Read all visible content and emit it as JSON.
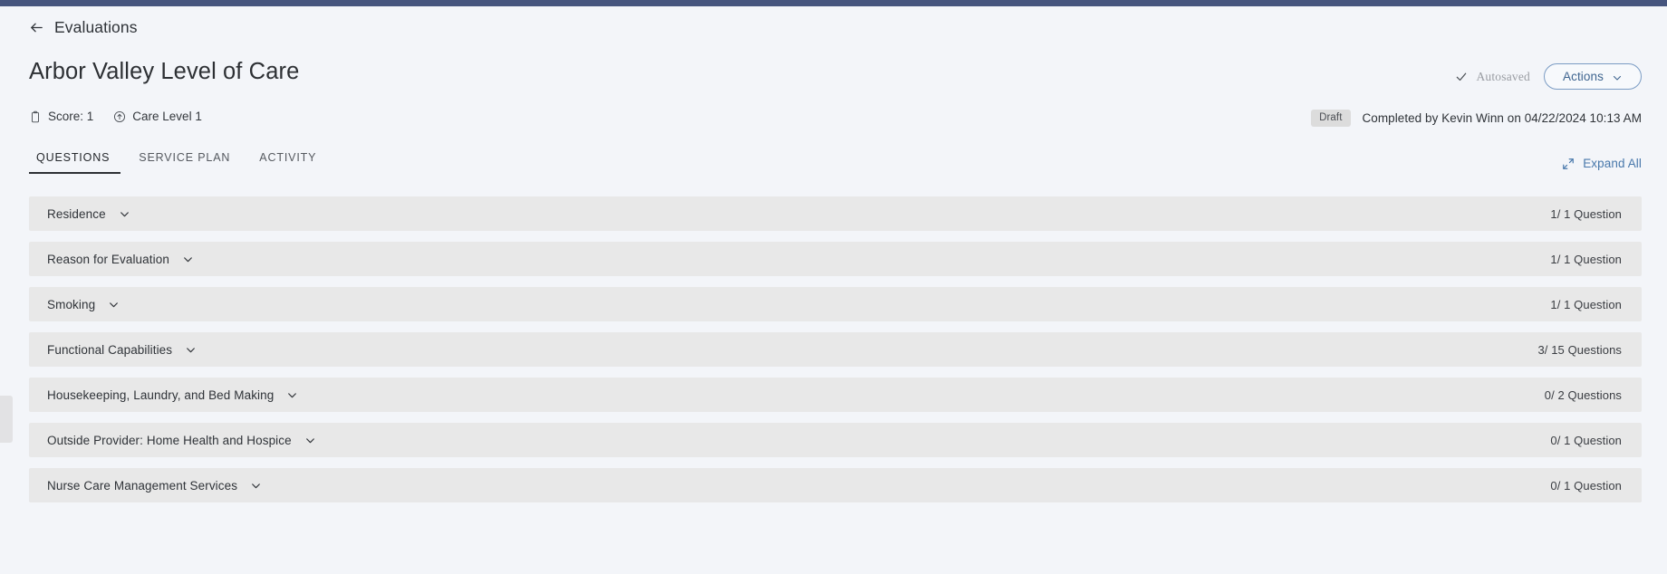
{
  "theme": {
    "top_bar_color": "#46557e",
    "page_background": "#f3f5f9",
    "section_row_color": "#e8e8e8",
    "accent_blue": "#4878ab",
    "badge_grey": "#dcdcdc"
  },
  "breadcrumb": {
    "back_icon": "arrow-left-icon",
    "label": "Evaluations"
  },
  "header": {
    "title": "Arbor Valley Level of Care",
    "meta": [
      {
        "icon": "clipboard-icon",
        "label": "Score: 1"
      },
      {
        "icon": "circle-arrow-up-icon",
        "label": "Care Level 1"
      }
    ],
    "autosave": {
      "icon": "check-icon",
      "label": "Autosaved"
    },
    "actions_button": {
      "label": "Actions",
      "icon": "chevron-down-icon"
    },
    "status": {
      "badge": "Draft",
      "completed_text": "Completed by Kevin Winn on 04/22/2024 10:13 AM"
    }
  },
  "tabs": {
    "items": [
      {
        "label": "QUESTIONS",
        "active": true
      },
      {
        "label": "SERVICE PLAN",
        "active": false
      },
      {
        "label": "ACTIVITY",
        "active": false
      }
    ],
    "expand_all": {
      "icon": "expand-icon",
      "label": "Expand All"
    }
  },
  "sections": [
    {
      "title": "Residence",
      "count": "1/ 1 Question",
      "chevron": "chevron-down-icon"
    },
    {
      "title": "Reason for Evaluation",
      "count": "1/ 1 Question",
      "chevron": "chevron-down-icon"
    },
    {
      "title": "Smoking",
      "count": "1/ 1 Question",
      "chevron": "chevron-down-icon"
    },
    {
      "title": "Functional Capabilities",
      "count": "3/ 15 Questions",
      "chevron": "chevron-down-icon"
    },
    {
      "title": "Housekeeping, Laundry, and Bed Making",
      "count": "0/ 2 Questions",
      "chevron": "chevron-down-icon"
    },
    {
      "title": "Outside Provider: Home Health and Hospice",
      "count": "0/ 1 Question",
      "chevron": "chevron-down-icon"
    },
    {
      "title": "Nurse Care Management Services",
      "count": "0/ 1 Question",
      "chevron": "chevron-down-icon"
    }
  ]
}
